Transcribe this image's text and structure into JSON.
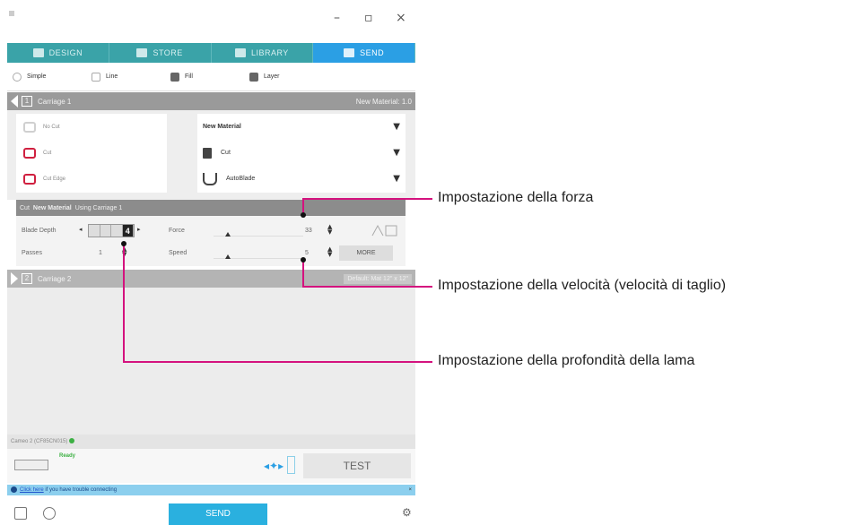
{
  "window": {
    "minimize": "–",
    "restore": "▫",
    "close": "×"
  },
  "tabs": [
    {
      "label": "DESIGN",
      "icon": "design-icon"
    },
    {
      "label": "STORE",
      "icon": "store-icon"
    },
    {
      "label": "LIBRARY",
      "icon": "library-icon"
    },
    {
      "label": "SEND",
      "icon": "send-icon",
      "active": true
    }
  ],
  "modes": [
    {
      "label": "Simple",
      "icon": "radio-icon"
    },
    {
      "label": "Line",
      "icon": "line-icon"
    },
    {
      "label": "Fill",
      "icon": "fill-icon"
    },
    {
      "label": "Layer",
      "icon": "layer-icon"
    }
  ],
  "carriage1": {
    "number": "1",
    "label": "Carriage 1",
    "right": "New Material: 1.0"
  },
  "actions": [
    {
      "label": "No Cut",
      "icon": "no-cut-icon"
    },
    {
      "label": "Cut",
      "icon": "cut-icon"
    },
    {
      "label": "Cut Edge",
      "icon": "cut-edge-icon"
    }
  ],
  "selects": [
    {
      "label": "New Material",
      "icon": "none"
    },
    {
      "label": "Cut",
      "icon": "cut-tool-icon"
    },
    {
      "label": "AutoBlade",
      "icon": "autoblade-icon"
    }
  ],
  "cutbar": {
    "prefix": "Cut",
    "material": "New Material",
    "suffix": "Using Carriage 1"
  },
  "params": {
    "blade_depth_label": "Blade Depth",
    "blade_depth_value": "4",
    "passes_label": "Passes",
    "passes_value": "1",
    "force_label": "Force",
    "force_value": "33",
    "speed_label": "Speed",
    "speed_value": "5",
    "more_label": "MORE"
  },
  "carriage2": {
    "number": "2",
    "label": "Carriage 2",
    "right": "Default: Mat 12\" x 12\""
  },
  "device": {
    "name": "Cameo 2 (CF85CN015)"
  },
  "status": {
    "ready": "Ready",
    "test_label": "TEST"
  },
  "infobar": {
    "link": "Click here",
    "text": "if you have trouble connecting"
  },
  "bottom": {
    "send_label": "SEND"
  },
  "callouts": {
    "force": "Impostazione della forza",
    "speed": "Impostazione della velocità (velocità di taglio)",
    "depth": "Impostazione della profondità della lama"
  },
  "colors": {
    "callout_line": "#d4127e",
    "send_tab": "#2b9fe4",
    "tabs_bg": "#3aa3a8",
    "ready": "#3cb043"
  }
}
